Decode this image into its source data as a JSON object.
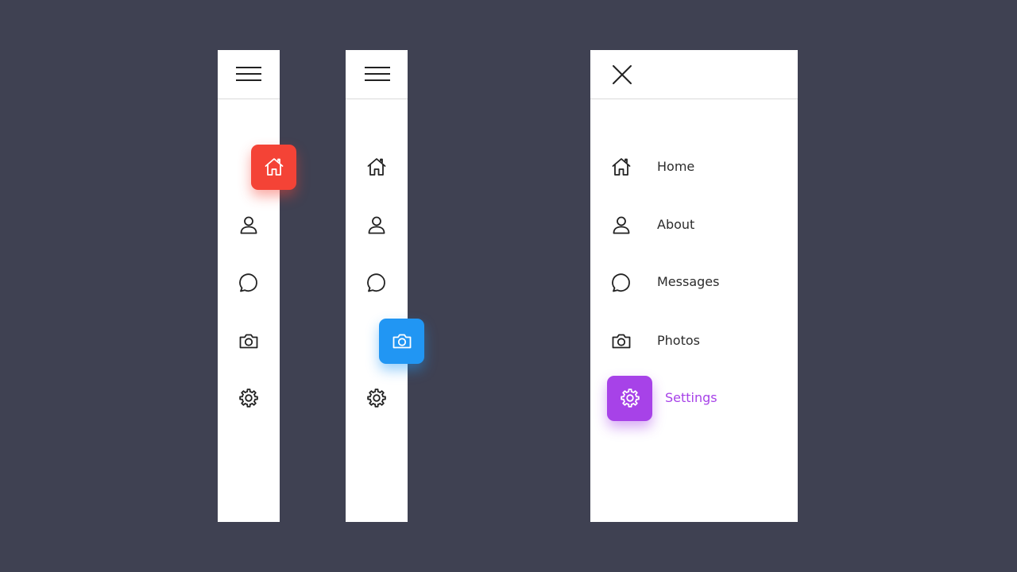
{
  "theme": {
    "background": "#3f4152",
    "panel": "#ffffff",
    "active_home": "#f44336",
    "active_photos": "#2196f3",
    "active_settings": "#a742e8",
    "icon_stroke": "#222222"
  },
  "panel_1": {
    "header": {
      "icon": "hamburger-icon"
    },
    "active": "home",
    "items": [
      {
        "id": "home",
        "icon": "home-icon"
      },
      {
        "id": "about",
        "icon": "user-icon"
      },
      {
        "id": "messages",
        "icon": "message-icon"
      },
      {
        "id": "photos",
        "icon": "camera-icon"
      },
      {
        "id": "settings",
        "icon": "gear-icon"
      }
    ]
  },
  "panel_2": {
    "header": {
      "icon": "hamburger-icon"
    },
    "active": "photos",
    "items": [
      {
        "id": "home",
        "icon": "home-icon"
      },
      {
        "id": "about",
        "icon": "user-icon"
      },
      {
        "id": "messages",
        "icon": "message-icon"
      },
      {
        "id": "photos",
        "icon": "camera-icon"
      },
      {
        "id": "settings",
        "icon": "gear-icon"
      }
    ]
  },
  "panel_3": {
    "header": {
      "icon": "close-icon"
    },
    "active": "settings",
    "items": [
      {
        "id": "home",
        "icon": "home-icon",
        "label": "Home"
      },
      {
        "id": "about",
        "icon": "user-icon",
        "label": "About"
      },
      {
        "id": "messages",
        "icon": "message-icon",
        "label": "Messages"
      },
      {
        "id": "photos",
        "icon": "camera-icon",
        "label": "Photos"
      },
      {
        "id": "settings",
        "icon": "gear-icon",
        "label": "Settings"
      }
    ]
  }
}
